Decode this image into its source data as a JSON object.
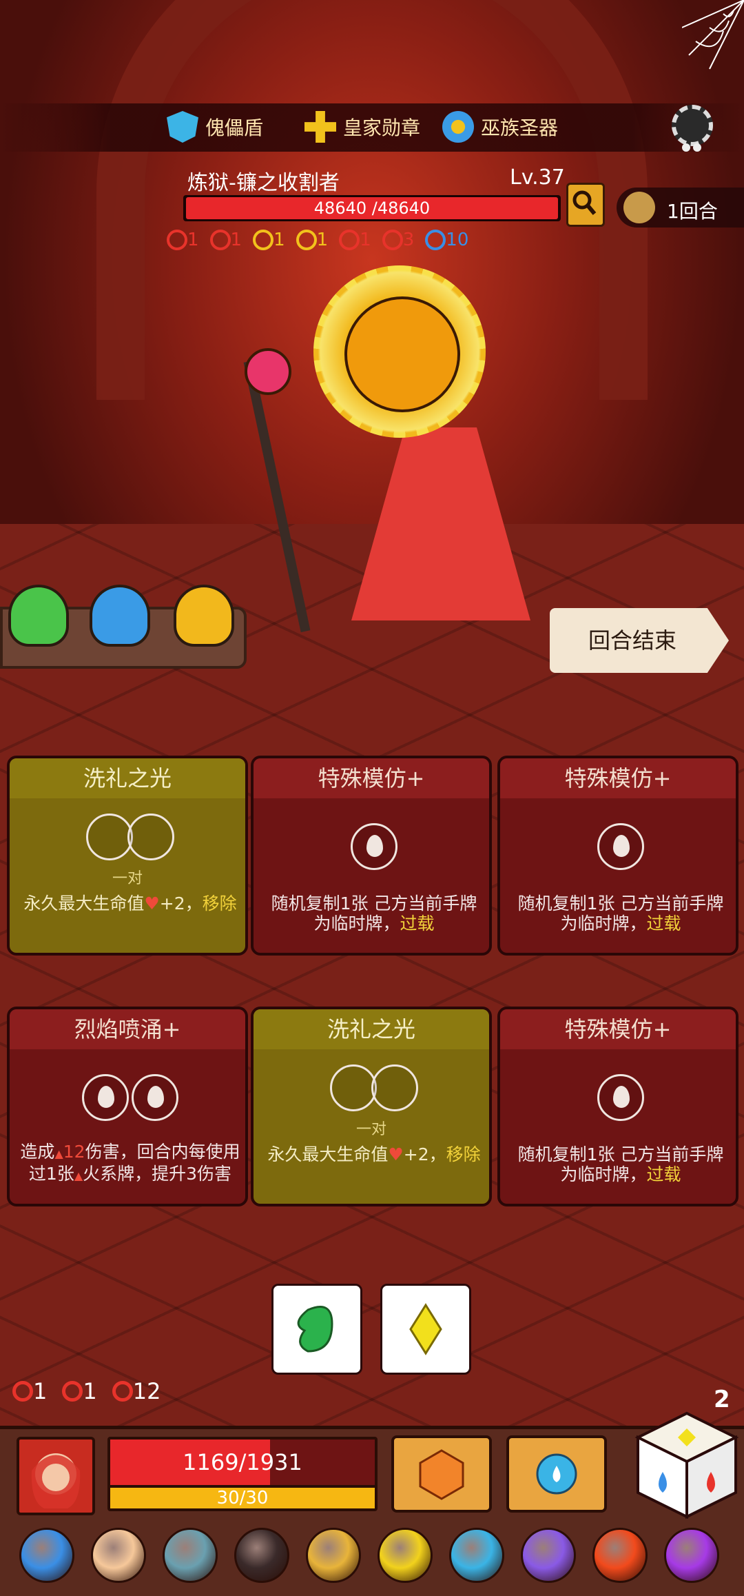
{
  "artifacts": [
    {
      "label": "傀儡盾",
      "icon": "puppet-shield-icon",
      "color": "#3cb4e6"
    },
    {
      "label": "皇家勋章",
      "icon": "royal-medal-icon",
      "color": "#f2c21c"
    },
    {
      "label": "巫族圣器",
      "icon": "witch-relic-icon",
      "color": "#3a9be6"
    }
  ],
  "boss": {
    "name": "炼狱-镰之收割者",
    "level": "Lv.37",
    "hp_text": "48640 /48640",
    "hp_fraction": 1.0,
    "statuses": [
      {
        "icon": "shield-status-icon",
        "value": "1",
        "color": "#e8332b"
      },
      {
        "icon": "spiral-status-icon",
        "value": "1",
        "color": "#e8332b"
      },
      {
        "icon": "armor-status-icon",
        "value": "1",
        "color": "#f2c21c"
      },
      {
        "icon": "star-status-icon",
        "value": "1",
        "color": "#f2c21c"
      },
      {
        "icon": "thorns-status-icon",
        "value": "1",
        "color": "#e8332b"
      },
      {
        "icon": "flame-status-icon",
        "value": "3",
        "color": "#e8332b"
      },
      {
        "icon": "vortex-status-icon",
        "value": "10",
        "color": "#3a8fe6"
      }
    ]
  },
  "round": {
    "label": "1回合"
  },
  "end_turn": {
    "label": "回合结束"
  },
  "cards": [
    {
      "title": "洗礼之光",
      "style": "gold",
      "slots": "pair",
      "sub": "一对",
      "desc": [
        "永久最大生命值",
        "+2，",
        "移除"
      ]
    },
    {
      "title": "特殊模仿+",
      "style": "red",
      "slots": "fire",
      "desc_a": "随机复制1张 己方当前手牌 为临时牌，",
      "desc_b": "过载"
    },
    {
      "title": "特殊模仿+",
      "style": "red",
      "slots": "fire",
      "desc_a": "随机复制1张 己方当前手牌 为临时牌，",
      "desc_b": "过载"
    },
    {
      "title": "烈焰喷涌+",
      "style": "red",
      "slots": "fire2",
      "desc_a": "造成",
      "dmg": "12",
      "desc_c": "伤害，回合内每使用过1张",
      "desc_d": "火系牌，提升3伤害"
    },
    {
      "title": "洗礼之光",
      "style": "gold",
      "slots": "pair",
      "sub": "一对",
      "desc": [
        "永久最大生命值",
        "+2，",
        "移除"
      ]
    },
    {
      "title": "特殊模仿+",
      "style": "red",
      "slots": "fire",
      "desc_a": "随机复制1张 己方当前手牌 为临时牌，",
      "desc_b": "过载"
    }
  ],
  "dice": [
    {
      "icon": "green-leaf-die-icon",
      "color": "#2bb24c"
    },
    {
      "icon": "yellow-diamond-die-icon",
      "color": "#f2e01c"
    }
  ],
  "player": {
    "statuses": [
      {
        "icon": "thorns-status-icon",
        "value": "1"
      },
      {
        "icon": "spiral-status-icon",
        "value": "1"
      },
      {
        "icon": "gear-burst-status-icon",
        "value": "12"
      }
    ],
    "hp_text": "1169/1931",
    "hp_fraction": 0.605,
    "energy_text": "30/30",
    "energy_fraction": 1.0,
    "dice_count": "2"
  },
  "relics": [
    {
      "icon": "blue-mushroom-relic-icon",
      "color": "#3a8fe6"
    },
    {
      "icon": "ring-relic-icon",
      "color": "#f6c89a"
    },
    {
      "icon": "axe-relic-icon",
      "color": "#6aa0b0"
    },
    {
      "icon": "crow-relic-icon",
      "color": "#3a2a2a"
    },
    {
      "icon": "lion-relic-icon",
      "color": "#e8b43a"
    },
    {
      "icon": "crown-relic-icon",
      "color": "#f2d21c"
    },
    {
      "icon": "blue-skull-relic-icon",
      "color": "#3ab4e6"
    },
    {
      "icon": "leaf-cup-relic-icon",
      "color": "#8a5ae6"
    },
    {
      "icon": "fire-relic-icon",
      "color": "#f24a1c"
    },
    {
      "icon": "purple-potion-relic-icon",
      "color": "#a63ae6"
    }
  ]
}
